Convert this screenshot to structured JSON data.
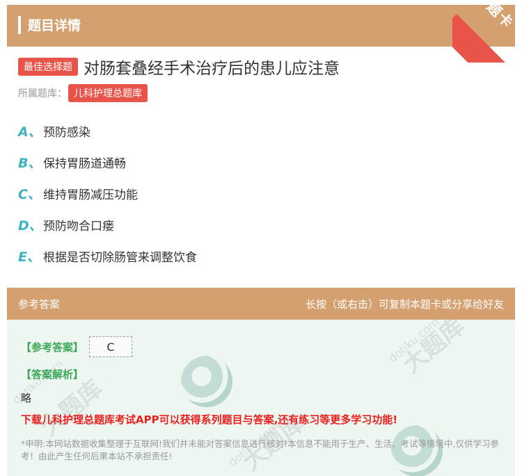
{
  "header": {
    "title": "题目详情"
  },
  "corner_ribbon": {
    "label": "题卡"
  },
  "question": {
    "type_tag": "最佳选择题",
    "text": "对肠套叠经手术治疗后的患儿应注意",
    "bank_label": "所属题库：",
    "bank_name": "儿科护理总题库"
  },
  "options": [
    {
      "letter": "A、",
      "text": "预防感染"
    },
    {
      "letter": "B、",
      "text": "保持胃肠道通畅"
    },
    {
      "letter": "C、",
      "text": "维持胃肠减压功能"
    },
    {
      "letter": "D、",
      "text": "预防吻合口瘘"
    },
    {
      "letter": "E、",
      "text": "根据是否切除肠管来调整饮食"
    }
  ],
  "answer_section": {
    "title": "参考答案",
    "hint": "长按（或右击）可复制本题卡或分享给好友",
    "answer_label": "【参考答案】",
    "answer_value": "C",
    "analysis_label": "【答案解析】",
    "analysis_text": "略",
    "download_text": "下载儿科护理总题库考试APP可以获得系列题目与答案,还有练习等更多学习功能!",
    "disclaimer": "*申明:本网站数据收集整理于互联网!我们并未能对答案信息进行核对!本信息不能用于生产、生活、考试等情境中,仅供学习参考！由此产生任何后果本站不承担责任!"
  },
  "watermark": {
    "brand": "大题库",
    "url": "dotiku.com"
  },
  "colors": {
    "header_bg": "#d4a070",
    "tag_red": "#e8544a",
    "option_letter": "#3cb4c0",
    "answer_green": "#3aa856",
    "download_red": "#e8201c",
    "answer_bg": "#eef6f2"
  }
}
